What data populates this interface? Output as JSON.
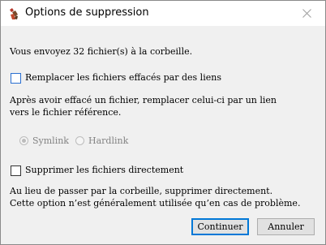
{
  "window": {
    "title": "Options de suppression",
    "app_icon": "app-icon",
    "close_icon": "close-icon"
  },
  "message": "Vous envoyez 32 fichier(s) à la corbeille.",
  "replace_option": {
    "label": "Remplacer les fichiers effacés par des liens",
    "checked": false,
    "description_line1": "Après avoir effacé un fichier, remplacer celui-ci par un lien",
    "description_line2": "vers le fichier référence."
  },
  "link_type": {
    "enabled": false,
    "options": [
      {
        "label": "Symlink",
        "selected": true
      },
      {
        "label": "Hardlink",
        "selected": false
      }
    ]
  },
  "delete_option": {
    "label": "Supprimer les fichiers directement",
    "checked": false,
    "description_line1": "Au lieu de passer par la corbeille, supprimer directement.",
    "description_line2": "Cette option n’est généralement utilisée qu’en cas de problème."
  },
  "buttons": {
    "continue": "Continuer",
    "cancel": "Annuler"
  },
  "colors": {
    "accent": "#0078d7",
    "background": "#f0f0f0",
    "titlebar": "#ffffff"
  }
}
